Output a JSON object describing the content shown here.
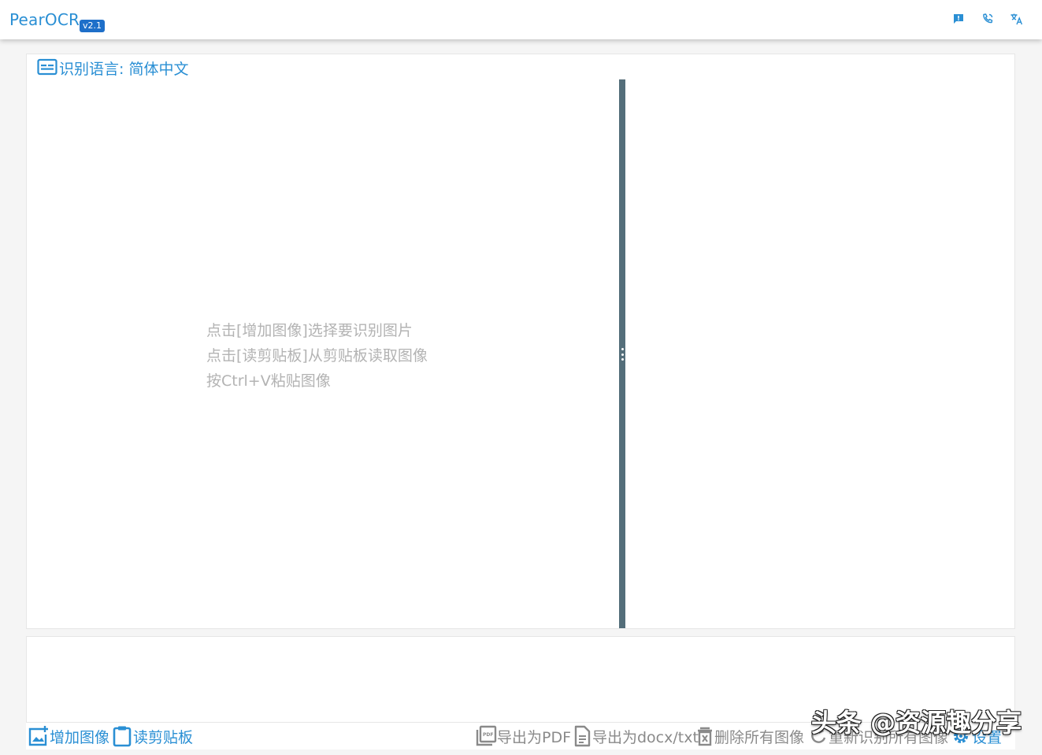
{
  "app": {
    "title": "PearOCR",
    "version": "v2.1",
    "accent_color": "#2a8fd4",
    "splitter_color": "#546e7a"
  },
  "topbar_icons": [
    "feedback-icon",
    "phone-icon",
    "translate-icon"
  ],
  "language_bar": {
    "icon": "subtitles-icon",
    "label": "识别语言: 简体中文"
  },
  "image_panel": {
    "hints": [
      "点击[增加图像]选择要识别图片",
      "点击[读剪贴板]从剪贴板读取图像",
      "按Ctrl+V粘贴图像"
    ]
  },
  "footer": {
    "add_image": "增加图像",
    "read_clipboard": "读剪贴板",
    "export_pdf": "导出为PDF",
    "export_docx": "导出为docx/txt",
    "delete_all": "删除所有图像",
    "recognize_all": "重新识别所有图像",
    "settings": "设置"
  },
  "watermark": "头条 @资源趣分享"
}
